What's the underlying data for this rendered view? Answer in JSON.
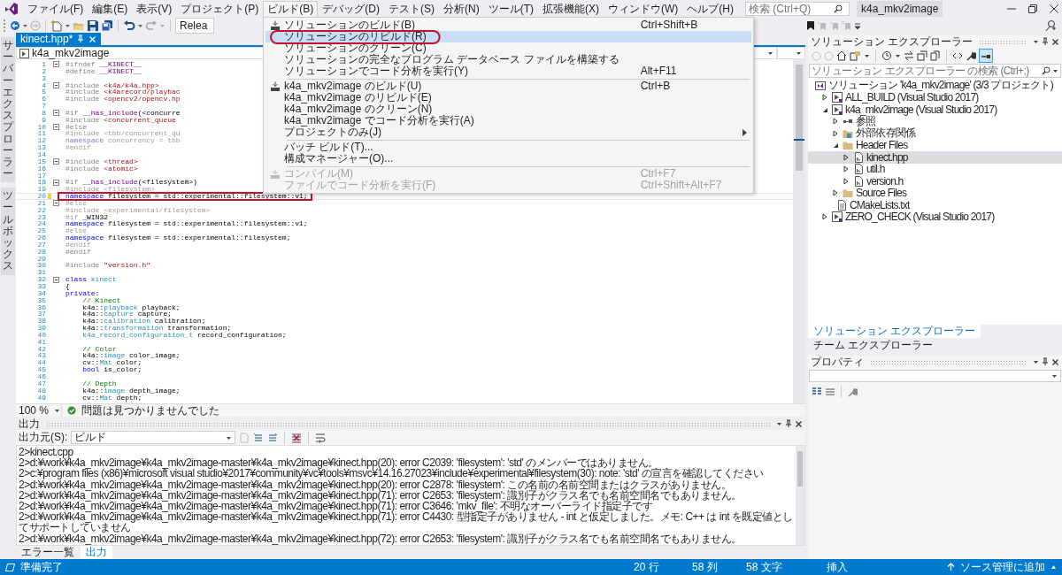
{
  "menu_bar": {
    "items": [
      {
        "label": "ファイル(F)",
        "selected": false
      },
      {
        "label": "編集(E)",
        "selected": false
      },
      {
        "label": "表示(V)",
        "selected": false
      },
      {
        "label": "プロジェクト(P)",
        "selected": false
      },
      {
        "label": "ビルド(B)",
        "selected": true
      },
      {
        "label": "デバッグ(D)",
        "selected": false
      },
      {
        "label": "テスト(S)",
        "selected": false
      },
      {
        "label": "分析(N)",
        "selected": false
      },
      {
        "label": "ツール(T)",
        "selected": false
      },
      {
        "label": "拡張機能(X)",
        "selected": false
      },
      {
        "label": "ウィンドウ(W)",
        "selected": false
      },
      {
        "label": "ヘルプ(H)",
        "selected": false
      }
    ],
    "search": {
      "placeholder": "検索 (Ctrl+Q)"
    },
    "title": "k4a_mkv2image"
  },
  "toolbar": {
    "configuration": "Relea"
  },
  "build_menu": {
    "items": [
      {
        "kind": "item",
        "label": "ソリューションのビルド(B)",
        "shortcut": "Ctrl+Shift+B",
        "has_icon": true,
        "highlighted": false,
        "annotated": false,
        "disabled": false
      },
      {
        "kind": "item",
        "label": "ソリューションのリビルド(R)",
        "has_icon": false,
        "highlighted": true,
        "annotated": true,
        "disabled": false
      },
      {
        "kind": "item",
        "label": "ソリューションのクリーン(C)",
        "has_icon": false,
        "highlighted": false,
        "annotated": false,
        "disabled": false
      },
      {
        "kind": "item",
        "label": "ソリューションの完全なプログラム データベース ファイルを構築する",
        "has_icon": false,
        "highlighted": false,
        "annotated": false,
        "disabled": false
      },
      {
        "kind": "item",
        "label": "ソリューションでコード分析を実行(Y)",
        "shortcut": "Alt+F11",
        "has_icon": false,
        "highlighted": false,
        "annotated": false,
        "disabled": false
      },
      {
        "kind": "separator"
      },
      {
        "kind": "item",
        "label": "k4a_mkv2image のビルド(U)",
        "shortcut": "Ctrl+B",
        "has_icon": true,
        "highlighted": false,
        "annotated": false,
        "disabled": false
      },
      {
        "kind": "item",
        "label": "k4a_mkv2image のリビルド(E)",
        "has_icon": false,
        "highlighted": false,
        "annotated": false,
        "disabled": false
      },
      {
        "kind": "item",
        "label": "k4a_mkv2image のクリーン(N)",
        "has_icon": false,
        "highlighted": false,
        "annotated": false,
        "disabled": false
      },
      {
        "kind": "item",
        "label": "k4a_mkv2image でコード分析を実行(A)",
        "has_icon": false,
        "highlighted": false,
        "annotated": false,
        "disabled": false
      },
      {
        "kind": "submenu",
        "label": "プロジェクトのみ(J)",
        "has_icon": false,
        "highlighted": false,
        "annotated": false,
        "disabled": false
      },
      {
        "kind": "separator"
      },
      {
        "kind": "item",
        "label": "バッチ ビルド(T)...",
        "has_icon": false,
        "highlighted": false,
        "annotated": false,
        "disabled": false
      },
      {
        "kind": "item",
        "label": "構成マネージャー(O)...",
        "has_icon": false,
        "highlighted": false,
        "annotated": false,
        "disabled": false
      },
      {
        "kind": "separator"
      },
      {
        "kind": "item",
        "label": "コンパイル(M)",
        "shortcut": "Ctrl+F7",
        "has_icon": true,
        "highlighted": false,
        "annotated": false,
        "disabled": true
      },
      {
        "kind": "item",
        "label": "ファイルでコード分析を実行(F)",
        "shortcut": "Ctrl+Shift+Alt+F7",
        "has_icon": false,
        "highlighted": false,
        "annotated": false,
        "disabled": true
      }
    ]
  },
  "side_tabs": [
    "サーバーエクスプローラー",
    "ツールボックス"
  ],
  "editor": {
    "tabs": [
      {
        "label": "kinect.hpp*",
        "selected": true
      }
    ],
    "navigation": [
      "k4a_mkv2image"
    ],
    "lines": [
      {
        "number": "1",
        "fold": true,
        "modified": false,
        "current": false,
        "annotated": false,
        "tokens": [
          {
            "kind": "pp",
            "text": "#ifndef"
          },
          {
            "kind": "mac",
            "text": " __KINECT__"
          }
        ]
      },
      {
        "number": "2",
        "fold": false,
        "modified": false,
        "current": false,
        "annotated": false,
        "tokens": [
          {
            "kind": "pp",
            "text": "#define"
          },
          {
            "kind": "mac",
            "text": " __KINECT__"
          }
        ]
      },
      {
        "number": "3",
        "fold": false,
        "modified": false,
        "current": false,
        "annotated": false
      },
      {
        "number": "4",
        "fold": true,
        "modified": false,
        "current": false,
        "annotated": false,
        "tokens": [
          {
            "kind": "pp",
            "text": "#include"
          },
          {
            "kind": "str",
            "text": " <k4a/k4a.hpp>"
          }
        ]
      },
      {
        "number": "5",
        "fold": false,
        "modified": false,
        "current": false,
        "annotated": false,
        "tokens": [
          {
            "kind": "pp",
            "text": "#include"
          },
          {
            "kind": "str",
            "text": " <k4arecord/playbac"
          }
        ]
      },
      {
        "number": "6",
        "fold": false,
        "modified": false,
        "current": false,
        "annotated": false,
        "tokens": [
          {
            "kind": "pp",
            "text": "#include"
          },
          {
            "kind": "str",
            "text": " <opencv2/opencv.hp"
          }
        ]
      },
      {
        "number": "7",
        "fold": false,
        "modified": false,
        "current": false,
        "annotated": false
      },
      {
        "number": "8",
        "fold": true,
        "modified": false,
        "current": false,
        "annotated": false,
        "tokens": [
          {
            "kind": "pp",
            "text": "#if"
          },
          {
            "kind": "mac",
            "text": " __has_include"
          },
          {
            "kind": "txt",
            "text": "(<concurre"
          }
        ]
      },
      {
        "number": "9",
        "fold": false,
        "modified": false,
        "current": false,
        "annotated": false,
        "tokens": [
          {
            "kind": "pp",
            "text": "#include"
          },
          {
            "kind": "str",
            "text": " <concurrent_queue"
          }
        ]
      },
      {
        "number": "10",
        "fold": true,
        "modified": false,
        "current": false,
        "annotated": false,
        "tokens": [
          {
            "kind": "pp",
            "text": "#else"
          }
        ]
      },
      {
        "number": "11",
        "fold": false,
        "modified": false,
        "current": false,
        "annotated": false,
        "tokens": [
          {
            "kind": "dim",
            "text": "#include <tbb/concurrent_qu"
          }
        ]
      },
      {
        "number": "12",
        "fold": false,
        "modified": false,
        "current": false,
        "annotated": false,
        "tokens": [
          {
            "kind": "dimkw",
            "text": "namespace"
          },
          {
            "kind": "dim",
            "text": " concurrency = tbb"
          }
        ]
      },
      {
        "number": "13",
        "fold": false,
        "modified": false,
        "current": false,
        "annotated": false,
        "tokens": [
          {
            "kind": "dim",
            "text": "#endif"
          }
        ]
      },
      {
        "number": "14",
        "fold": false,
        "modified": false,
        "current": false,
        "annotated": false
      },
      {
        "number": "15",
        "fold": true,
        "modified": false,
        "current": false,
        "annotated": false,
        "tokens": [
          {
            "kind": "pp",
            "text": "#include"
          },
          {
            "kind": "str",
            "text": " <thread>"
          }
        ]
      },
      {
        "number": "16",
        "fold": false,
        "modified": false,
        "current": false,
        "annotated": false,
        "tokens": [
          {
            "kind": "pp",
            "text": "#include"
          },
          {
            "kind": "str",
            "text": " <atomic>"
          }
        ]
      },
      {
        "number": "17",
        "fold": false,
        "modified": false,
        "current": false,
        "annotated": false
      },
      {
        "number": "18",
        "fold": true,
        "modified": false,
        "current": false,
        "annotated": false,
        "tokens": [
          {
            "kind": "pp",
            "text": "#if"
          },
          {
            "kind": "mac",
            "text": " __has_include"
          },
          {
            "kind": "txt",
            "text": "(<filesystem>)"
          }
        ]
      },
      {
        "number": "19",
        "fold": false,
        "modified": false,
        "current": false,
        "annotated": false,
        "tokens": [
          {
            "kind": "dim",
            "text": "#include <filesystem>"
          }
        ]
      },
      {
        "number": "20",
        "fold": false,
        "modified": true,
        "current": true,
        "annotated": true,
        "tokens": [
          {
            "kind": "kw",
            "text": "namespace"
          },
          {
            "kind": "txt",
            "text": " filesystem = std::experimental::filesystem::v1;"
          }
        ]
      },
      {
        "number": "21",
        "fold": true,
        "modified": false,
        "current": false,
        "annotated": false,
        "tokens": [
          {
            "kind": "dim",
            "text": "#else"
          }
        ]
      },
      {
        "number": "22",
        "fold": false,
        "modified": false,
        "current": false,
        "annotated": false,
        "tokens": [
          {
            "kind": "dim",
            "text": "#include <experimental/filesystem>"
          }
        ]
      },
      {
        "number": "23",
        "fold": false,
        "modified": false,
        "current": false,
        "annotated": false,
        "tokens": [
          {
            "kind": "dim",
            "text": "#if"
          },
          {
            "kind": "txt",
            "text": " _WIN32"
          }
        ]
      },
      {
        "number": "24",
        "fold": false,
        "modified": false,
        "current": false,
        "annotated": false,
        "tokens": [
          {
            "kind": "kw",
            "text": "namespace"
          },
          {
            "kind": "txt",
            "text": " filesystem = std::experimental::filesystem::v1;"
          }
        ]
      },
      {
        "number": "25",
        "fold": false,
        "modified": false,
        "current": false,
        "annotated": false,
        "tokens": [
          {
            "kind": "dim",
            "text": "#else"
          }
        ]
      },
      {
        "number": "26",
        "fold": false,
        "modified": false,
        "current": false,
        "annotated": false,
        "tokens": [
          {
            "kind": "kw",
            "text": "namespace"
          },
          {
            "kind": "txt",
            "text": " filesystem = std::experimental::filesystem;"
          }
        ]
      },
      {
        "number": "27",
        "fold": false,
        "modified": false,
        "current": false,
        "annotated": false,
        "tokens": [
          {
            "kind": "dim",
            "text": "#endif"
          }
        ]
      },
      {
        "number": "28",
        "fold": false,
        "modified": false,
        "current": false,
        "annotated": false,
        "tokens": [
          {
            "kind": "pp",
            "text": "#endif"
          }
        ]
      },
      {
        "number": "29",
        "fold": false,
        "modified": false,
        "current": false,
        "annotated": false
      },
      {
        "number": "30",
        "fold": false,
        "modified": false,
        "current": false,
        "annotated": false,
        "tokens": [
          {
            "kind": "pp",
            "text": "#include"
          },
          {
            "kind": "str",
            "text": " \"version.h\""
          }
        ]
      },
      {
        "number": "31",
        "fold": false,
        "modified": false,
        "current": false,
        "annotated": false
      },
      {
        "number": "32",
        "fold": true,
        "modified": false,
        "current": false,
        "annotated": false,
        "tokens": [
          {
            "kind": "kw",
            "text": "class"
          },
          {
            "kind": "type",
            "text": " kinect"
          }
        ]
      },
      {
        "number": "33",
        "fold": false,
        "modified": false,
        "current": false,
        "annotated": false,
        "tokens": [
          {
            "kind": "txt",
            "text": "{"
          }
        ]
      },
      {
        "number": "34",
        "fold": false,
        "modified": false,
        "current": false,
        "annotated": false,
        "tokens": [
          {
            "kind": "kw",
            "text": "private"
          },
          {
            "kind": "txt",
            "text": ":"
          }
        ]
      },
      {
        "number": "35",
        "fold": false,
        "modified": false,
        "current": false,
        "annotated": false,
        "tokens": [
          {
            "kind": "cmt",
            "text": "    // Kinect"
          }
        ]
      },
      {
        "number": "36",
        "fold": false,
        "modified": false,
        "current": false,
        "annotated": false,
        "tokens": [
          {
            "kind": "txt",
            "text": "    k4a::"
          },
          {
            "kind": "type",
            "text": "playback"
          },
          {
            "kind": "txt",
            "text": " playback;"
          }
        ]
      },
      {
        "number": "37",
        "fold": false,
        "modified": false,
        "current": false,
        "annotated": false,
        "tokens": [
          {
            "kind": "txt",
            "text": "    k4a::"
          },
          {
            "kind": "type",
            "text": "capture"
          },
          {
            "kind": "txt",
            "text": " capture;"
          }
        ]
      },
      {
        "number": "38",
        "fold": false,
        "modified": false,
        "current": false,
        "annotated": false,
        "tokens": [
          {
            "kind": "txt",
            "text": "    k4a::"
          },
          {
            "kind": "type",
            "text": "calibration"
          },
          {
            "kind": "txt",
            "text": " calibration;"
          }
        ]
      },
      {
        "number": "39",
        "fold": false,
        "modified": false,
        "current": false,
        "annotated": false,
        "tokens": [
          {
            "kind": "txt",
            "text": "    k4a::"
          },
          {
            "kind": "type",
            "text": "transformation"
          },
          {
            "kind": "txt",
            "text": " transformation;"
          }
        ]
      },
      {
        "number": "40",
        "fold": false,
        "modified": false,
        "current": false,
        "annotated": false,
        "tokens": [
          {
            "kind": "type",
            "text": "    k4a_record_configuration_t"
          },
          {
            "kind": "txt",
            "text": " record_configuration;"
          }
        ]
      },
      {
        "number": "41",
        "fold": false,
        "modified": false,
        "current": false,
        "annotated": false
      },
      {
        "number": "42",
        "fold": false,
        "modified": false,
        "current": false,
        "annotated": false,
        "tokens": [
          {
            "kind": "cmt",
            "text": "    // Color"
          }
        ]
      },
      {
        "number": "43",
        "fold": false,
        "modified": false,
        "current": false,
        "annotated": false,
        "tokens": [
          {
            "kind": "txt",
            "text": "    k4a::"
          },
          {
            "kind": "type",
            "text": "image"
          },
          {
            "kind": "txt",
            "text": " color_image;"
          }
        ]
      },
      {
        "number": "44",
        "fold": false,
        "modified": false,
        "current": false,
        "annotated": false,
        "tokens": [
          {
            "kind": "txt",
            "text": "    cv::"
          },
          {
            "kind": "type",
            "text": "Mat"
          },
          {
            "kind": "txt",
            "text": " color;"
          }
        ]
      },
      {
        "number": "45",
        "fold": false,
        "modified": false,
        "current": false,
        "annotated": false,
        "tokens": [
          {
            "kind": "kw",
            "text": "    bool"
          },
          {
            "kind": "txt",
            "text": " is_color;"
          }
        ]
      },
      {
        "number": "46",
        "fold": false,
        "modified": false,
        "current": false,
        "annotated": false
      },
      {
        "number": "47",
        "fold": false,
        "modified": false,
        "current": false,
        "annotated": false,
        "tokens": [
          {
            "kind": "cmt",
            "text": "    // Depth"
          }
        ]
      },
      {
        "number": "48",
        "fold": false,
        "modified": false,
        "current": false,
        "annotated": false,
        "tokens": [
          {
            "kind": "txt",
            "text": "    k4a::"
          },
          {
            "kind": "type",
            "text": "image"
          },
          {
            "kind": "txt",
            "text": " depth_image;"
          }
        ]
      },
      {
        "number": "49",
        "fold": false,
        "modified": false,
        "current": false,
        "annotated": false,
        "tokens": [
          {
            "kind": "txt",
            "text": "    cv::"
          },
          {
            "kind": "type",
            "text": "Mat"
          },
          {
            "kind": "txt",
            "text": " depth;"
          }
        ]
      }
    ],
    "zoom": "100 %",
    "issues": "問題は見つかりませんでした"
  },
  "output": {
    "title": "出力",
    "source_label": "出力元(S):",
    "source": "ビルド",
    "lines": [
      "2>kinect.cpp",
      "2>d:¥work¥k4a_mkv2image¥k4a_mkv2image-master¥k4a_mkv2image¥kinect.hpp(20): error C2039: 'filesystem': 'std' のメンバーではありません。",
      "2>c:¥program files (x86)¥microsoft visual studio¥2017¥community¥vc¥tools¥msvc¥14.16.27023¥include¥experimental¥filesystem(30): note: 'std' の宣言を確認してください",
      "2>d:¥work¥k4a_mkv2image¥k4a_mkv2image-master¥k4a_mkv2image¥kinect.hpp(20): error C2878: 'filesystem': この名前の名前空間またはクラスがありません。",
      "2>d:¥work¥k4a_mkv2image¥k4a_mkv2image-master¥k4a_mkv2image¥kinect.hpp(71): error C2653: 'filesystem': 識別子がクラス名でも名前空間名でもありません。",
      "2>d:¥work¥k4a_mkv2image¥k4a_mkv2image-master¥k4a_mkv2image¥kinect.hpp(71): error C3646: 'mkv_file': 不明なオーバーライド指定子です",
      "2>d:¥work¥k4a_mkv2image¥k4a_mkv2image-master¥k4a_mkv2image¥kinect.hpp(71): error C4430: 型指定子がありません - int と仮定しました。メモ: C++ は int を既定値としてサポートしていません",
      "2>d:¥work¥k4a_mkv2image¥k4a_mkv2image-master¥k4a_mkv2image¥kinect.hpp(72): error C2653: 'filesystem': 識別子がクラス名でも名前空間名でもありません。"
    ]
  },
  "bottom_tabs": [
    {
      "label": "エラー一覧",
      "selected": false
    },
    {
      "label": "出力",
      "selected": true
    }
  ],
  "solution_explorer": {
    "title": "ソリューション エクスプローラー",
    "search": {
      "placeholder": "ソリューション エクスプローラー の検索 (Ctrl+;)"
    },
    "tree": [
      {
        "kind": "solution",
        "label": "ソリューション 'k4a_mkv2image' (3/3 プロジェクト)",
        "selected": false,
        "children": [
          {
            "kind": "project",
            "label": "ALL_BUILD (Visual Studio 2017)",
            "selected": false,
            "expanded": false
          },
          {
            "kind": "project",
            "label": "k4a_mkv2image (Visual Studio 2017)",
            "selected": false,
            "expanded": true,
            "children": [
              {
                "kind": "references",
                "label": "参照",
                "selected": false,
                "expanded": false
              },
              {
                "kind": "dependencies",
                "label": "外部依存関係",
                "selected": false,
                "expanded": false
              },
              {
                "kind": "folder",
                "label": "Header Files",
                "selected": false,
                "expanded": true,
                "children": [
                  {
                    "kind": "file",
                    "label": "kinect.hpp",
                    "selected": true,
                    "expanded": false
                  },
                  {
                    "kind": "file",
                    "label": "util.h",
                    "selected": false,
                    "expanded": false
                  },
                  {
                    "kind": "file",
                    "label": "version.h",
                    "selected": false,
                    "expanded": false
                  }
                ]
              },
              {
                "kind": "folder",
                "label": "Source Files",
                "selected": false,
                "expanded": false
              },
              {
                "kind": "text",
                "label": "CMakeLists.txt",
                "selected": false
              }
            ]
          },
          {
            "kind": "project",
            "label": "ZERO_CHECK (Visual Studio 2017)",
            "selected": false,
            "expanded": false
          }
        ]
      }
    ]
  },
  "right_tabs": [
    {
      "label": "ソリューション エクスプローラー",
      "selected": true
    },
    {
      "label": "チーム エクスプローラー",
      "selected": false
    }
  ],
  "properties": {
    "title": "プロパティ"
  },
  "status_bar": {
    "message": "準備完了",
    "line": "20 行",
    "column": "58 列",
    "character": "58 文字",
    "mode": "挿入",
    "source_control": "ソース管理に追加"
  }
}
